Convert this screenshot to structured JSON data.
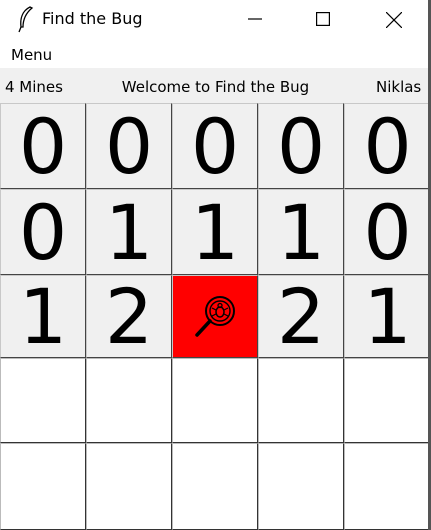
{
  "window": {
    "title": "Find the Bug",
    "icon": "feather-icon",
    "controls": [
      "minimize-icon",
      "maximize-icon",
      "close-icon"
    ]
  },
  "menu": {
    "label": "Menu"
  },
  "status": {
    "mines": "4 Mines",
    "welcome": "Welcome to Find the Bug",
    "player": "Niklas"
  },
  "board": {
    "rows": 5,
    "cols": 5,
    "cells": [
      [
        "0",
        "0",
        "0",
        "0",
        "0"
      ],
      [
        "0",
        "1",
        "1",
        "1",
        "0"
      ],
      [
        "1",
        "2",
        "bug",
        "2",
        "1"
      ],
      [
        "",
        "",
        "",
        "",
        ""
      ],
      [
        "",
        "",
        "",
        "",
        ""
      ]
    ],
    "revealed": [
      [
        true,
        true,
        true,
        true,
        true
      ],
      [
        true,
        true,
        true,
        true,
        true
      ],
      [
        true,
        true,
        true,
        true,
        true
      ],
      [
        false,
        false,
        false,
        false,
        false
      ],
      [
        false,
        false,
        false,
        false,
        false
      ]
    ],
    "colors": {
      "bug_background": "#ff0000",
      "revealed": "#f0f0f0",
      "hidden": "#ffffff"
    },
    "bug_icon": "bug-magnifier-icon"
  }
}
